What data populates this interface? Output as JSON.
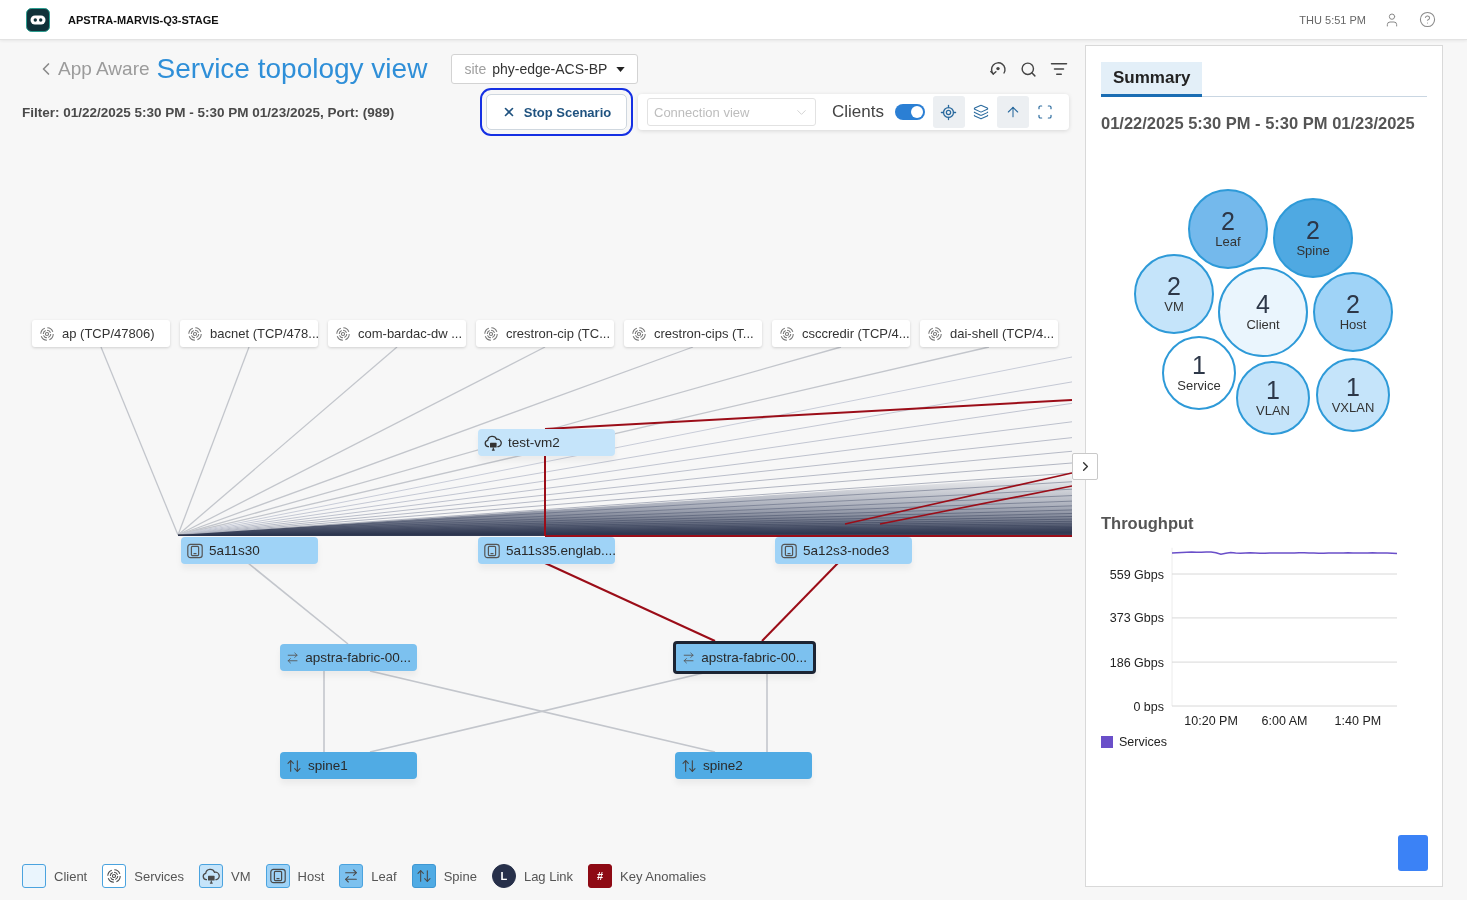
{
  "top_bar": {
    "title": "APSTRA-MARVIS-Q3-STAGE",
    "clock": "THU 5:51 PM"
  },
  "header": {
    "back_label": "App Aware",
    "title": "Service topology view",
    "site": {
      "label": "site",
      "value": "phy-edge-ACS-BP"
    }
  },
  "filter": "Filter: 01/22/2025 5:30 PM - 5:30 PM 01/23/2025, Port: (989)",
  "stop_button": {
    "label": "Stop Scenario",
    "focused": true
  },
  "toolbar": {
    "view_select": {
      "placeholder": "Connection view",
      "disabled": true
    },
    "clients_toggle": {
      "label": "Clients",
      "on": true
    },
    "tools": [
      {
        "selected": true
      },
      {
        "selected": false
      },
      {
        "selected": true
      },
      {
        "selected": false
      }
    ]
  },
  "topology": {
    "services": [
      {
        "label": "ap (TCP/47806)"
      },
      {
        "label": "bacnet (TCP/478..."
      },
      {
        "label": "com-bardac-dw ..."
      },
      {
        "label": "crestron-cip (TC..."
      },
      {
        "label": "crestron-cips (T..."
      },
      {
        "label": "csccredir (TCP/4..."
      },
      {
        "label": "dai-shell (TCP/4..."
      }
    ],
    "nodes": [
      {
        "kind": "vm",
        "label": "test-vm2",
        "selected": false
      },
      {
        "kind": "host",
        "label": "5a11s30",
        "selected": false
      },
      {
        "kind": "host",
        "label": "5a11s35.englab....",
        "selected": false
      },
      {
        "kind": "host",
        "label": "5a12s3-node3",
        "selected": false
      },
      {
        "kind": "leaf",
        "label": "apstra-fabric-00...",
        "selected": false
      },
      {
        "kind": "leaf",
        "label": "apstra-fabric-00...",
        "selected": true
      },
      {
        "kind": "spine",
        "label": "spine1",
        "selected": false
      },
      {
        "kind": "spine",
        "label": "spine2",
        "selected": false
      }
    ]
  },
  "legend": [
    {
      "kind": "client",
      "label": "Client"
    },
    {
      "kind": "service",
      "label": "Services"
    },
    {
      "kind": "vm",
      "label": "VM"
    },
    {
      "kind": "host",
      "label": "Host"
    },
    {
      "kind": "leaf",
      "label": "Leaf"
    },
    {
      "kind": "spine",
      "label": "Spine"
    },
    {
      "kind": "lag",
      "label": "Lag Link",
      "symbol": "L"
    },
    {
      "kind": "anomaly",
      "label": "Key Anomalies",
      "symbol": "#"
    }
  ],
  "summary": {
    "tabs": [
      {
        "label": "Summary",
        "selected": true
      }
    ],
    "range": "01/22/2025 5:30 PM - 5:30 PM 01/23/2025",
    "bubbles": [
      {
        "count": "2",
        "label": "Leaf",
        "color": "#74b9ec"
      },
      {
        "count": "2",
        "label": "Spine",
        "color": "#4fa9e2"
      },
      {
        "count": "2",
        "label": "VM",
        "color": "#c5e4fa"
      },
      {
        "count": "4",
        "label": "Client",
        "color": "#eaf5fd"
      },
      {
        "count": "2",
        "label": "Host",
        "color": "#9fd3f7"
      },
      {
        "count": "1",
        "label": "Service",
        "color": "#ffffff"
      },
      {
        "count": "1",
        "label": "VLAN",
        "color": "#c5e4fa"
      },
      {
        "count": "1",
        "label": "VXLAN",
        "color": "#c5e4fa"
      }
    ],
    "throughput": {
      "title": "Throughput",
      "chart_data": {
        "type": "line",
        "categories": [
          null,
          null,
          null,
          null,
          null,
          null,
          null,
          null,
          "10:20 PM",
          null,
          null,
          null,
          null,
          null,
          null,
          null,
          null,
          null,
          null,
          null,
          null,
          null,
          null,
          "6:00 AM",
          null,
          null,
          null,
          null,
          null,
          null,
          null,
          null,
          null,
          null,
          null,
          null,
          null,
          null,
          "1:40 PM",
          null,
          null,
          null,
          null,
          null,
          null,
          null,
          null
        ],
        "series": [
          {
            "name": "Services",
            "color": "#6a4fc9",
            "values": [
              648,
              649,
              650,
              651,
              652,
              651,
              651,
              652,
              652,
              649,
              643,
              647,
              650,
              648,
              647,
              648,
              649,
              648,
              647,
              647,
              648,
              648,
              648,
              648,
              648,
              648,
              649,
              649,
              648,
              648,
              647,
              647,
              648,
              648,
              648,
              648,
              649,
              648,
              648,
              648,
              648,
              649,
              648,
              648,
              648,
              647,
              646
            ]
          }
        ],
        "grid": true,
        "ylim": [
          0,
          670
        ],
        "yticks": [
          {
            "value": 0,
            "label": "0 bps"
          },
          {
            "value": 186,
            "label": "186 Gbps"
          },
          {
            "value": 373,
            "label": "373 Gbps"
          },
          {
            "value": 559,
            "label": "559 Gbps"
          }
        ]
      }
    }
  }
}
